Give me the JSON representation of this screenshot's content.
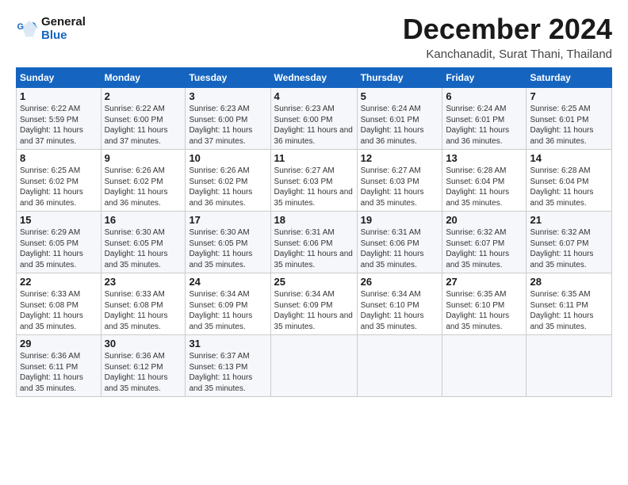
{
  "logo": {
    "line1": "General",
    "line2": "Blue"
  },
  "title": "December 2024",
  "subtitle": "Kanchanadit, Surat Thani, Thailand",
  "days_of_week": [
    "Sunday",
    "Monday",
    "Tuesday",
    "Wednesday",
    "Thursday",
    "Friday",
    "Saturday"
  ],
  "weeks": [
    [
      {
        "day": 1,
        "sunrise": "6:22 AM",
        "sunset": "5:59 PM",
        "daylight": "11 hours and 37 minutes."
      },
      {
        "day": 2,
        "sunrise": "6:22 AM",
        "sunset": "6:00 PM",
        "daylight": "11 hours and 37 minutes."
      },
      {
        "day": 3,
        "sunrise": "6:23 AM",
        "sunset": "6:00 PM",
        "daylight": "11 hours and 37 minutes."
      },
      {
        "day": 4,
        "sunrise": "6:23 AM",
        "sunset": "6:00 PM",
        "daylight": "11 hours and 36 minutes."
      },
      {
        "day": 5,
        "sunrise": "6:24 AM",
        "sunset": "6:01 PM",
        "daylight": "11 hours and 36 minutes."
      },
      {
        "day": 6,
        "sunrise": "6:24 AM",
        "sunset": "6:01 PM",
        "daylight": "11 hours and 36 minutes."
      },
      {
        "day": 7,
        "sunrise": "6:25 AM",
        "sunset": "6:01 PM",
        "daylight": "11 hours and 36 minutes."
      }
    ],
    [
      {
        "day": 8,
        "sunrise": "6:25 AM",
        "sunset": "6:02 PM",
        "daylight": "11 hours and 36 minutes."
      },
      {
        "day": 9,
        "sunrise": "6:26 AM",
        "sunset": "6:02 PM",
        "daylight": "11 hours and 36 minutes."
      },
      {
        "day": 10,
        "sunrise": "6:26 AM",
        "sunset": "6:02 PM",
        "daylight": "11 hours and 36 minutes."
      },
      {
        "day": 11,
        "sunrise": "6:27 AM",
        "sunset": "6:03 PM",
        "daylight": "11 hours and 35 minutes."
      },
      {
        "day": 12,
        "sunrise": "6:27 AM",
        "sunset": "6:03 PM",
        "daylight": "11 hours and 35 minutes."
      },
      {
        "day": 13,
        "sunrise": "6:28 AM",
        "sunset": "6:04 PM",
        "daylight": "11 hours and 35 minutes."
      },
      {
        "day": 14,
        "sunrise": "6:28 AM",
        "sunset": "6:04 PM",
        "daylight": "11 hours and 35 minutes."
      }
    ],
    [
      {
        "day": 15,
        "sunrise": "6:29 AM",
        "sunset": "6:05 PM",
        "daylight": "11 hours and 35 minutes."
      },
      {
        "day": 16,
        "sunrise": "6:30 AM",
        "sunset": "6:05 PM",
        "daylight": "11 hours and 35 minutes."
      },
      {
        "day": 17,
        "sunrise": "6:30 AM",
        "sunset": "6:05 PM",
        "daylight": "11 hours and 35 minutes."
      },
      {
        "day": 18,
        "sunrise": "6:31 AM",
        "sunset": "6:06 PM",
        "daylight": "11 hours and 35 minutes."
      },
      {
        "day": 19,
        "sunrise": "6:31 AM",
        "sunset": "6:06 PM",
        "daylight": "11 hours and 35 minutes."
      },
      {
        "day": 20,
        "sunrise": "6:32 AM",
        "sunset": "6:07 PM",
        "daylight": "11 hours and 35 minutes."
      },
      {
        "day": 21,
        "sunrise": "6:32 AM",
        "sunset": "6:07 PM",
        "daylight": "11 hours and 35 minutes."
      }
    ],
    [
      {
        "day": 22,
        "sunrise": "6:33 AM",
        "sunset": "6:08 PM",
        "daylight": "11 hours and 35 minutes."
      },
      {
        "day": 23,
        "sunrise": "6:33 AM",
        "sunset": "6:08 PM",
        "daylight": "11 hours and 35 minutes."
      },
      {
        "day": 24,
        "sunrise": "6:34 AM",
        "sunset": "6:09 PM",
        "daylight": "11 hours and 35 minutes."
      },
      {
        "day": 25,
        "sunrise": "6:34 AM",
        "sunset": "6:09 PM",
        "daylight": "11 hours and 35 minutes."
      },
      {
        "day": 26,
        "sunrise": "6:34 AM",
        "sunset": "6:10 PM",
        "daylight": "11 hours and 35 minutes."
      },
      {
        "day": 27,
        "sunrise": "6:35 AM",
        "sunset": "6:10 PM",
        "daylight": "11 hours and 35 minutes."
      },
      {
        "day": 28,
        "sunrise": "6:35 AM",
        "sunset": "6:11 PM",
        "daylight": "11 hours and 35 minutes."
      }
    ],
    [
      {
        "day": 29,
        "sunrise": "6:36 AM",
        "sunset": "6:11 PM",
        "daylight": "11 hours and 35 minutes."
      },
      {
        "day": 30,
        "sunrise": "6:36 AM",
        "sunset": "6:12 PM",
        "daylight": "11 hours and 35 minutes."
      },
      {
        "day": 31,
        "sunrise": "6:37 AM",
        "sunset": "6:13 PM",
        "daylight": "11 hours and 35 minutes."
      },
      null,
      null,
      null,
      null
    ]
  ]
}
